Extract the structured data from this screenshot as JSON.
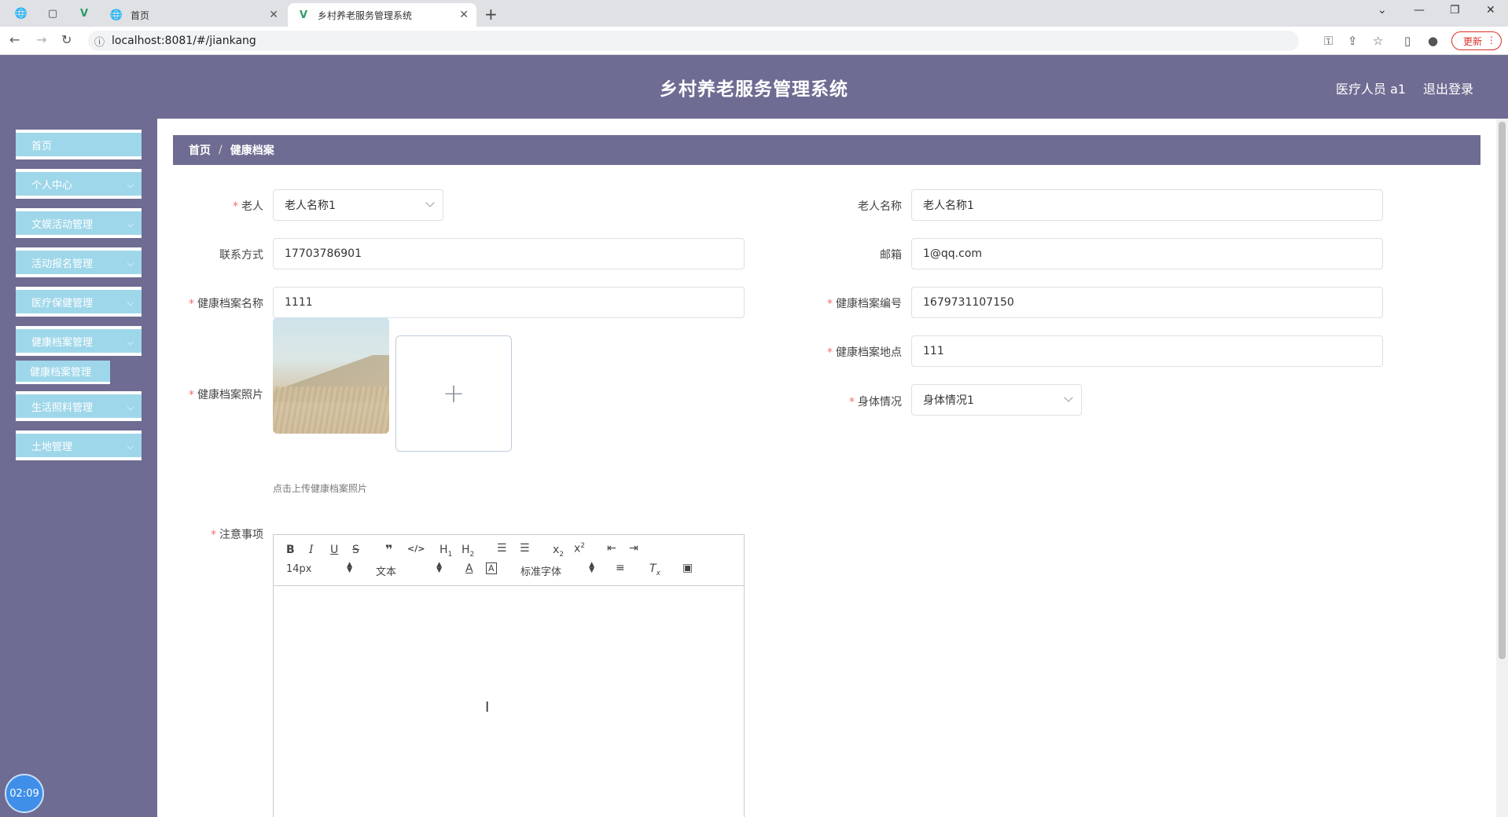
{
  "browser": {
    "tabs": [
      {
        "title": "首页",
        "active": false
      },
      {
        "title": "乡村养老服务管理系统",
        "active": true
      }
    ],
    "new_tab": "+",
    "url": "localhost:8081/#/jiankang",
    "update_label": "更新"
  },
  "header": {
    "title": "乡村养老服务管理系统",
    "user": "医疗人员 a1",
    "logout": "退出登录"
  },
  "sidebar": {
    "items": [
      {
        "label": "首页",
        "has_submenu": false
      },
      {
        "label": "个人中心",
        "has_submenu": true
      },
      {
        "label": "文娱活动管理",
        "has_submenu": true
      },
      {
        "label": "活动报名管理",
        "has_submenu": true
      },
      {
        "label": "医疗保健管理",
        "has_submenu": true
      },
      {
        "label": "健康档案管理",
        "has_submenu": true
      },
      {
        "label": "生活照料管理",
        "has_submenu": true
      },
      {
        "label": "土地管理",
        "has_submenu": true
      }
    ],
    "subitem": "健康档案管理",
    "clock": "02:09"
  },
  "breadcrumb": {
    "home": "首页",
    "current": "健康档案"
  },
  "form": {
    "laoren": {
      "label": "老人",
      "value": "老人名称1",
      "required": true
    },
    "laorenmingcheng": {
      "label": "老人名称",
      "value": "老人名称1"
    },
    "lianxifangshi": {
      "label": "联系方式",
      "value": "17703786901"
    },
    "youxiang": {
      "label": "邮箱",
      "value": "1@qq.com"
    },
    "dangan_name": {
      "label": "健康档案名称",
      "value": "1111",
      "required": true
    },
    "dangan_no": {
      "label": "健康档案编号",
      "value": "1679731107150",
      "required": true
    },
    "dangan_place": {
      "label": "健康档案地点",
      "value": "111",
      "required": true
    },
    "photo": {
      "label": "健康档案照片",
      "tip": "点击上传健康档案照片",
      "required": true
    },
    "shenti": {
      "label": "身体情况",
      "value": "身体情况1",
      "required": true
    },
    "zhuyi": {
      "label": "注意事项",
      "required": true
    }
  },
  "editor": {
    "font_size": "14px",
    "header_select": "文本",
    "font_family": "标准字体"
  },
  "colors": {
    "header_bg": "#6e6c92",
    "menu_item_bg": "#9fd7ea",
    "required": "#f56c6c"
  }
}
